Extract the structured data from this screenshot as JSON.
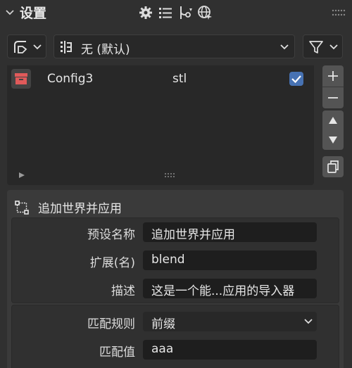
{
  "header": {
    "title": "设置",
    "icons": [
      "gear-icon",
      "list-icon",
      "sort-icon",
      "globe-icon"
    ]
  },
  "toolbar": {
    "preset_icon": "preset-icon",
    "select_value": "无 (默认)",
    "filter_icon": "filter-icon"
  },
  "list": {
    "items": [
      {
        "name": "Config3",
        "ext": "stl",
        "checked": true
      }
    ]
  },
  "side_buttons": [
    "add",
    "remove",
    "move-up",
    "move-down",
    "copy"
  ],
  "panel": {
    "title": "追加世界并应用",
    "props1": [
      {
        "label": "预设名称",
        "value": "追加世界并应用"
      },
      {
        "label": "扩展(名)",
        "value": "blend"
      },
      {
        "label": "描述",
        "value": "这是一个能...应用的导入器"
      }
    ],
    "props2": [
      {
        "label": "匹配规则",
        "value": "前缀"
      },
      {
        "label": "匹配值",
        "value": "aaa"
      }
    ]
  },
  "colors": {
    "accent": "#4772b3",
    "bg": "#303030",
    "field": "#1e1e1e"
  }
}
